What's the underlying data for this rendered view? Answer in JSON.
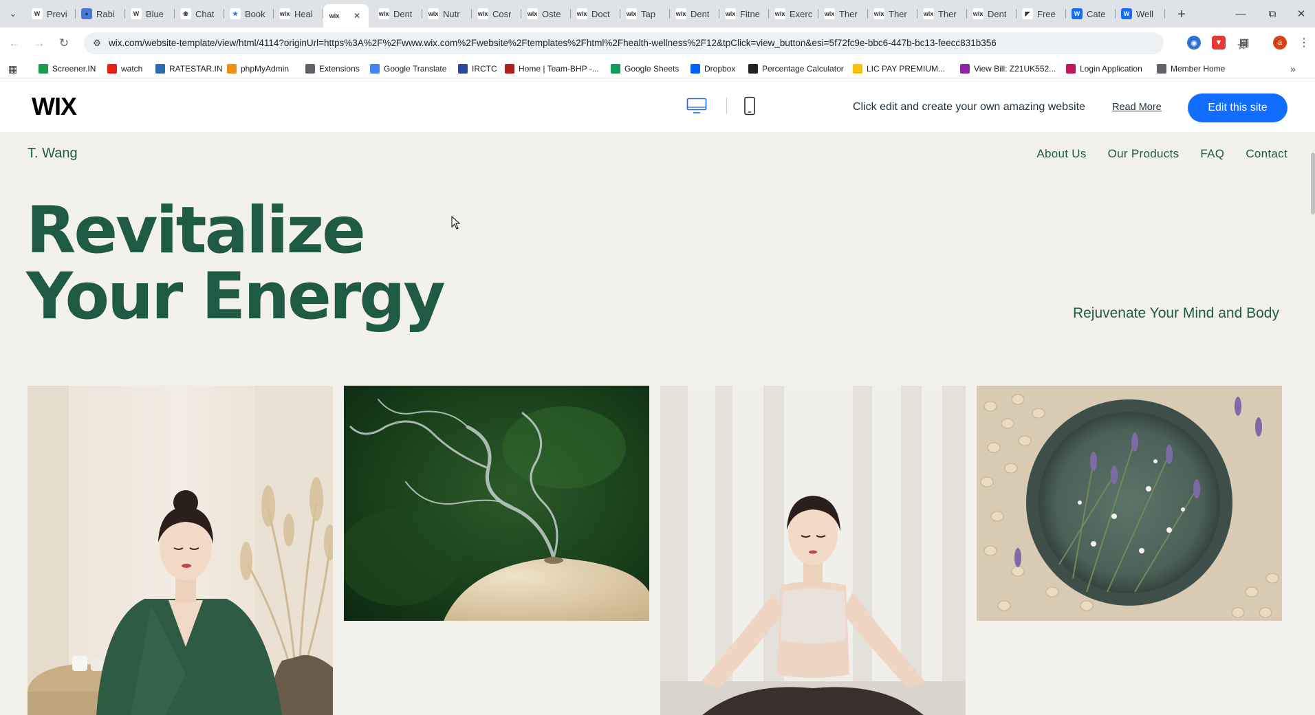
{
  "browser": {
    "tabs": [
      {
        "label": "Previ",
        "icon": "wikipedia-icon"
      },
      {
        "label": "Rabi",
        "icon": "globe-icon"
      },
      {
        "label": "Blue",
        "icon": "wikipedia-icon"
      },
      {
        "label": "Chat",
        "icon": "chatgpt-icon"
      },
      {
        "label": "Book",
        "icon": "star-icon"
      },
      {
        "label": "Heal",
        "icon": "wix-icon"
      },
      {
        "label": "",
        "icon": "wix-icon",
        "active": true
      },
      {
        "label": "Dent",
        "icon": "wix-icon"
      },
      {
        "label": "Nutr",
        "icon": "wix-icon"
      },
      {
        "label": "Cosr",
        "icon": "wix-icon"
      },
      {
        "label": "Oste",
        "icon": "wix-icon"
      },
      {
        "label": "Doct",
        "icon": "wix-icon"
      },
      {
        "label": "Tap",
        "icon": "wix-icon"
      },
      {
        "label": "Dent",
        "icon": "wix-icon"
      },
      {
        "label": "Fitne",
        "icon": "wix-icon"
      },
      {
        "label": "Exerc",
        "icon": "wix-icon"
      },
      {
        "label": "Ther",
        "icon": "wix-icon"
      },
      {
        "label": "Ther",
        "icon": "wix-icon"
      },
      {
        "label": "Ther",
        "icon": "wix-icon"
      },
      {
        "label": "Dent",
        "icon": "wix-icon"
      },
      {
        "label": "Free",
        "icon": "framer-icon"
      },
      {
        "label": "Cate",
        "icon": "webflow-icon"
      },
      {
        "label": "Well",
        "icon": "webflow-icon"
      }
    ],
    "url": "wix.com/website-template/view/html/4114?originUrl=https%3A%2F%2Fwww.wix.com%2Fwebsite%2Ftemplates%2Fhtml%2Fhealth-wellness%2F12&tpClick=view_button&esi=5f72fc9e-bbc6-447b-bc13-feecc831b356",
    "profile_initial": "a",
    "bookmarks": [
      {
        "label": "Screener.IN",
        "icon": "bar-chart-icon",
        "color": "#1a9e4b"
      },
      {
        "label": "watch",
        "icon": "youtube-icon",
        "color": "#e62117"
      },
      {
        "label": "RATESTAR.IN",
        "icon": "sparkle-icon",
        "color": "#2b6cb0"
      },
      {
        "label": "phpMyAdmin",
        "icon": "phpmyadmin-icon",
        "color": "#f29111"
      },
      {
        "label": "Extensions",
        "icon": "puzzle-icon",
        "color": "#5f6368"
      },
      {
        "label": "Google Translate",
        "icon": "translate-icon",
        "color": "#4285f4"
      },
      {
        "label": "IRCTC",
        "icon": "irctc-icon",
        "color": "#2b4a9b"
      },
      {
        "label": "Home | Team-BHP -...",
        "icon": "teambhp-icon",
        "color": "#b71c1c"
      },
      {
        "label": "Google Sheets",
        "icon": "sheets-icon",
        "color": "#0f9d58"
      },
      {
        "label": "Dropbox",
        "icon": "dropbox-icon",
        "color": "#0061fe"
      },
      {
        "label": "Percentage Calculator",
        "icon": "percent-icon",
        "color": "#222222"
      },
      {
        "label": "LIC PAY PREMIUM...",
        "icon": "lic-icon",
        "color": "#f4c20d"
      },
      {
        "label": "View Bill: Z21UK552...",
        "icon": "bill-icon",
        "color": "#8e24aa"
      },
      {
        "label": "Login Application",
        "icon": "login-icon",
        "color": "#c2185b"
      },
      {
        "label": "Member Home",
        "icon": "globe-icon",
        "color": "#5f6368"
      }
    ]
  },
  "wix": {
    "logo": "WIX",
    "tagline": "Click edit and create your own amazing website",
    "read_more": "Read More",
    "edit_button": "Edit this site",
    "accent": "#116dff"
  },
  "site": {
    "brand": "T. Wang",
    "nav": [
      "About Us",
      "Our Products",
      "FAQ",
      "Contact"
    ],
    "hero_title_line1": "Revitalize",
    "hero_title_line2": "Your Energy",
    "hero_subtitle": "Rejuvenate Your Mind and Body",
    "brand_color": "#1f5a44",
    "background": "#f2f1ec",
    "images": [
      {
        "icon": "woman-green-robe-photo"
      },
      {
        "icon": "incense-diffuser-smoke-photo"
      },
      {
        "icon": "woman-meditating-photo"
      },
      {
        "icon": "lavender-bowl-beans-photo"
      }
    ]
  }
}
